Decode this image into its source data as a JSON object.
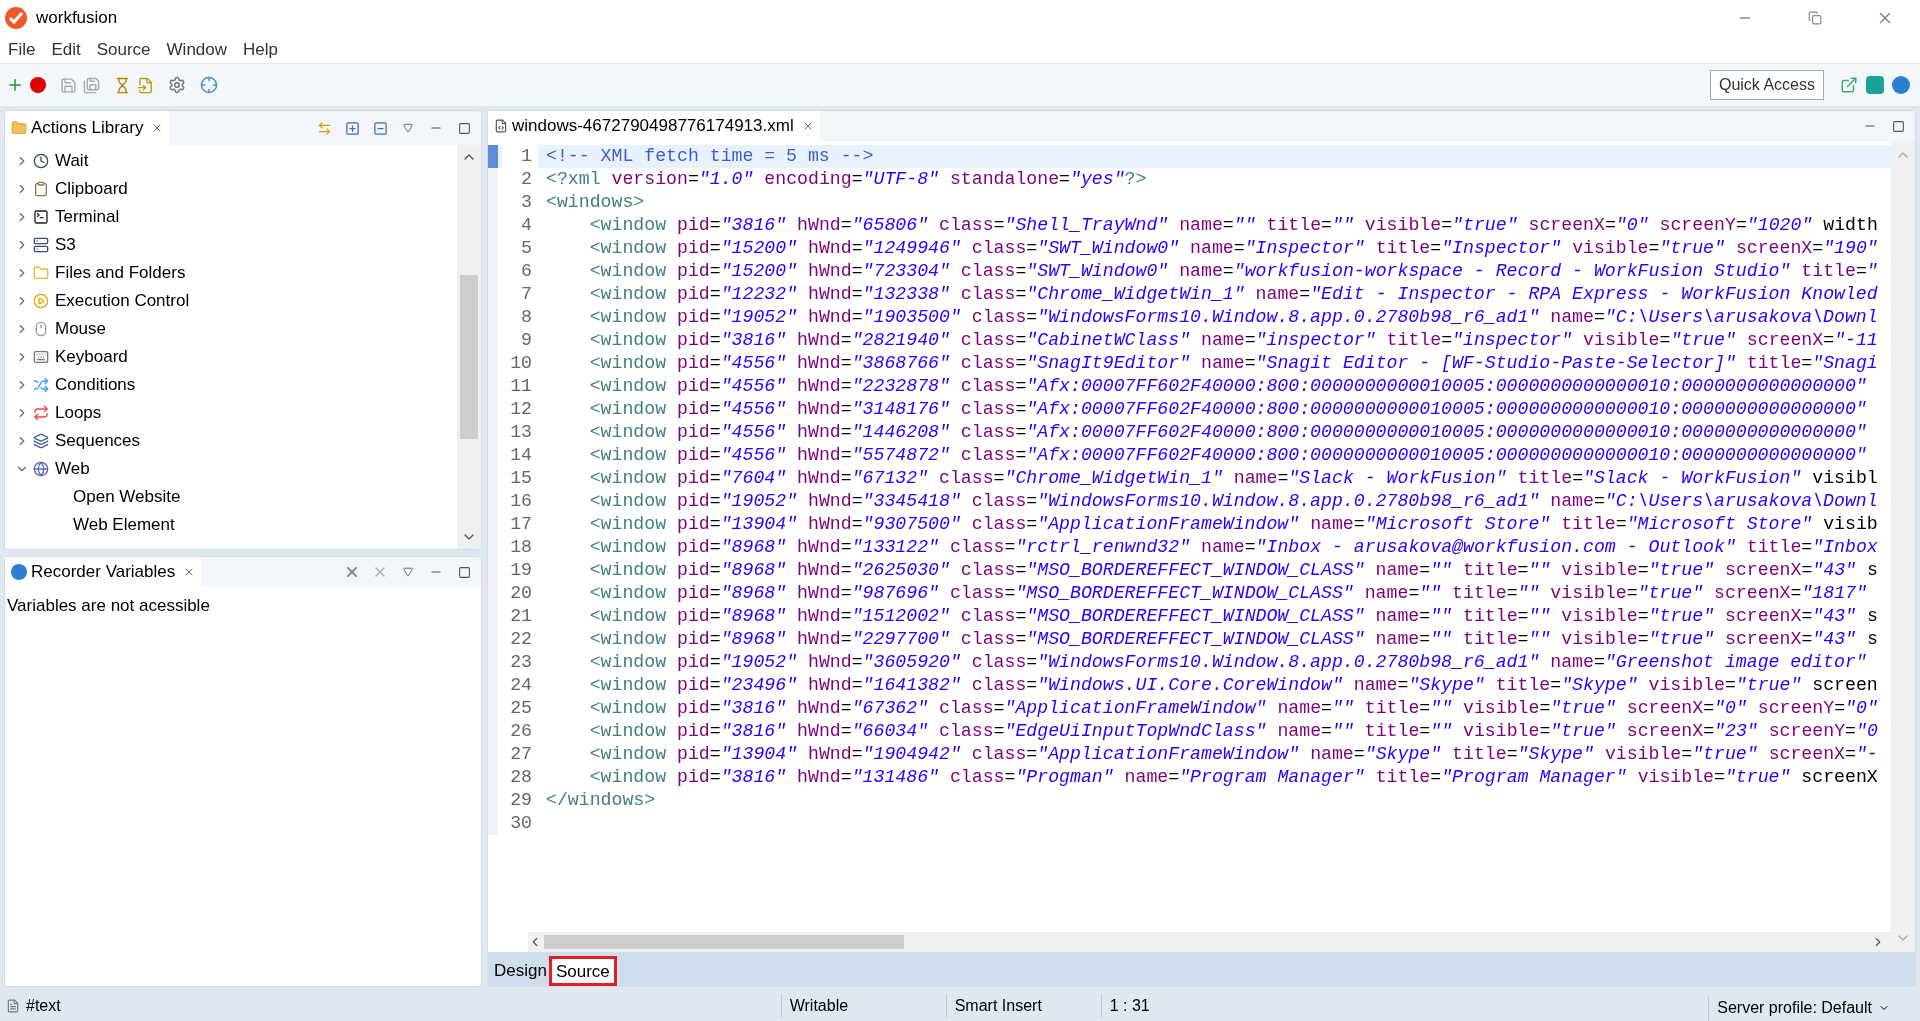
{
  "app": {
    "title": "workfusion"
  },
  "menu": [
    "File",
    "Edit",
    "Source",
    "Window",
    "Help"
  ],
  "toolbar": {
    "quick_access": "Quick Access"
  },
  "actions_library": {
    "title": "Actions Library",
    "items": [
      {
        "label": "Wait",
        "expanded": false
      },
      {
        "label": "Clipboard",
        "expanded": false
      },
      {
        "label": "Terminal",
        "expanded": false
      },
      {
        "label": "S3",
        "expanded": false
      },
      {
        "label": "Files and Folders",
        "expanded": false
      },
      {
        "label": "Execution Control",
        "expanded": false
      },
      {
        "label": "Mouse",
        "expanded": false
      },
      {
        "label": "Keyboard",
        "expanded": false
      },
      {
        "label": "Conditions",
        "expanded": false
      },
      {
        "label": "Loops",
        "expanded": false
      },
      {
        "label": "Sequences",
        "expanded": false
      },
      {
        "label": "Web",
        "expanded": true,
        "children": [
          {
            "label": "Open Website"
          },
          {
            "label": "Web Element"
          }
        ]
      }
    ]
  },
  "recorder_variables": {
    "title": "Recorder Variables",
    "message": "Variables are not acessible"
  },
  "editor": {
    "tab": "windows-4672790498776174913.xml",
    "lines": [
      {
        "number": "1",
        "selected": true,
        "text": "<!-- XML fetch time = 5 ms -->"
      },
      {
        "number": "2",
        "selected": false,
        "text": "<?xml version=\"1.0\" encoding=\"UTF-8\" standalone=\"yes\"?>"
      },
      {
        "number": "3",
        "selected": false,
        "text": "<windows>"
      },
      {
        "number": "4",
        "selected": false,
        "text": "    <window pid=\"3816\" hWnd=\"65806\" class=\"Shell_TrayWnd\" name=\"\" title=\"\" visible=\"true\" screenX=\"0\" screenY=\"1020\" width"
      },
      {
        "number": "5",
        "selected": false,
        "text": "    <window pid=\"15200\" hWnd=\"1249946\" class=\"SWT_Window0\" name=\"Inspector\" title=\"Inspector\" visible=\"true\" screenX=\"190\""
      },
      {
        "number": "6",
        "selected": false,
        "text": "    <window pid=\"15200\" hWnd=\"723304\" class=\"SWT_Window0\" name=\"workfusion-workspace - Record - WorkFusion Studio\" title=\""
      },
      {
        "number": "7",
        "selected": false,
        "text": "    <window pid=\"12232\" hWnd=\"132338\" class=\"Chrome_WidgetWin_1\" name=\"Edit - Inspector - RPA Express - WorkFusion Knowled"
      },
      {
        "number": "8",
        "selected": false,
        "text": "    <window pid=\"19052\" hWnd=\"1903500\" class=\"WindowsForms10.Window.8.app.0.2780b98_r6_ad1\" name=\"C:\\Users\\arusakova\\Downl"
      },
      {
        "number": "9",
        "selected": false,
        "text": "    <window pid=\"3816\" hWnd=\"2821940\" class=\"CabinetWClass\" name=\"inspector\" title=\"inspector\" visible=\"true\" screenX=\"-11"
      },
      {
        "number": "10",
        "selected": false,
        "text": "    <window pid=\"4556\" hWnd=\"3868766\" class=\"SnagIt9Editor\" name=\"Snagit Editor - [WF-Studio-Paste-Selector]\" title=\"Snagi"
      },
      {
        "number": "11",
        "selected": false,
        "text": "    <window pid=\"4556\" hWnd=\"2232878\" class=\"Afx:00007FF602F40000:800:0000000000010005:0000000000000010:0000000000000000\""
      },
      {
        "number": "12",
        "selected": false,
        "text": "    <window pid=\"4556\" hWnd=\"3148176\" class=\"Afx:00007FF602F40000:800:0000000000010005:0000000000000010:0000000000000000\""
      },
      {
        "number": "13",
        "selected": false,
        "text": "    <window pid=\"4556\" hWnd=\"1446208\" class=\"Afx:00007FF602F40000:800:0000000000010005:0000000000000010:0000000000000000\""
      },
      {
        "number": "14",
        "selected": false,
        "text": "    <window pid=\"4556\" hWnd=\"5574872\" class=\"Afx:00007FF602F40000:800:0000000000010005:0000000000000010:0000000000000000\""
      },
      {
        "number": "15",
        "selected": false,
        "text": "    <window pid=\"7604\" hWnd=\"67132\" class=\"Chrome_WidgetWin_1\" name=\"Slack - WorkFusion\" title=\"Slack - WorkFusion\" visibl"
      },
      {
        "number": "16",
        "selected": false,
        "text": "    <window pid=\"19052\" hWnd=\"3345418\" class=\"WindowsForms10.Window.8.app.0.2780b98_r6_ad1\" name=\"C:\\Users\\arusakova\\Downl"
      },
      {
        "number": "17",
        "selected": false,
        "text": "    <window pid=\"13904\" hWnd=\"9307500\" class=\"ApplicationFrameWindow\" name=\"Microsoft Store\" title=\"Microsoft Store\" visib"
      },
      {
        "number": "18",
        "selected": false,
        "text": "    <window pid=\"8968\" hWnd=\"133122\" class=\"rctrl_renwnd32\" name=\"Inbox - arusakova@workfusion.com - Outlook\" title=\"Inbox"
      },
      {
        "number": "19",
        "selected": false,
        "text": "    <window pid=\"8968\" hWnd=\"2625030\" class=\"MSO_BORDEREFFECT_WINDOW_CLASS\" name=\"\" title=\"\" visible=\"true\" screenX=\"43\" s"
      },
      {
        "number": "20",
        "selected": false,
        "text": "    <window pid=\"8968\" hWnd=\"987696\" class=\"MSO_BORDEREFFECT_WINDOW_CLASS\" name=\"\" title=\"\" visible=\"true\" screenX=\"1817\""
      },
      {
        "number": "21",
        "selected": false,
        "text": "    <window pid=\"8968\" hWnd=\"1512002\" class=\"MSO_BORDEREFFECT_WINDOW_CLASS\" name=\"\" title=\"\" visible=\"true\" screenX=\"43\" s"
      },
      {
        "number": "22",
        "selected": false,
        "text": "    <window pid=\"8968\" hWnd=\"2297700\" class=\"MSO_BORDEREFFECT_WINDOW_CLASS\" name=\"\" title=\"\" visible=\"true\" screenX=\"43\" s"
      },
      {
        "number": "23",
        "selected": false,
        "text": "    <window pid=\"19052\" hWnd=\"3605920\" class=\"WindowsForms10.Window.8.app.0.2780b98_r6_ad1\" name=\"Greenshot image editor\""
      },
      {
        "number": "24",
        "selected": false,
        "text": "    <window pid=\"23496\" hWnd=\"1641382\" class=\"Windows.UI.Core.CoreWindow\" name=\"Skype\" title=\"Skype\" visible=\"true\" screen"
      },
      {
        "number": "25",
        "selected": false,
        "text": "    <window pid=\"3816\" hWnd=\"67362\" class=\"ApplicationFrameWindow\" name=\"\" title=\"\" visible=\"true\" screenX=\"0\" screenY=\"0\""
      },
      {
        "number": "26",
        "selected": false,
        "text": "    <window pid=\"3816\" hWnd=\"66034\" class=\"EdgeUiInputTopWndClass\" name=\"\" title=\"\" visible=\"true\" screenX=\"23\" screenY=\"0"
      },
      {
        "number": "27",
        "selected": false,
        "text": "    <window pid=\"13904\" hWnd=\"1904942\" class=\"ApplicationFrameWindow\" name=\"Skype\" title=\"Skype\" visible=\"true\" screenX=\"-"
      },
      {
        "number": "28",
        "selected": false,
        "text": "    <window pid=\"3816\" hWnd=\"131486\" class=\"Progman\" name=\"Program Manager\" title=\"Program Manager\" visible=\"true\" screenX"
      },
      {
        "number": "29",
        "selected": false,
        "text": "</windows>"
      },
      {
        "number": "30",
        "selected": false
      }
    ]
  },
  "bottom_tabs": [
    {
      "label": "Design",
      "selected": false
    },
    {
      "label": "Source",
      "selected": true
    }
  ],
  "status_bar": {
    "node": "#text",
    "mode": "Writable",
    "insert": "Smart Insert",
    "position": "1 : 31",
    "profile": "Server profile: Default"
  }
}
